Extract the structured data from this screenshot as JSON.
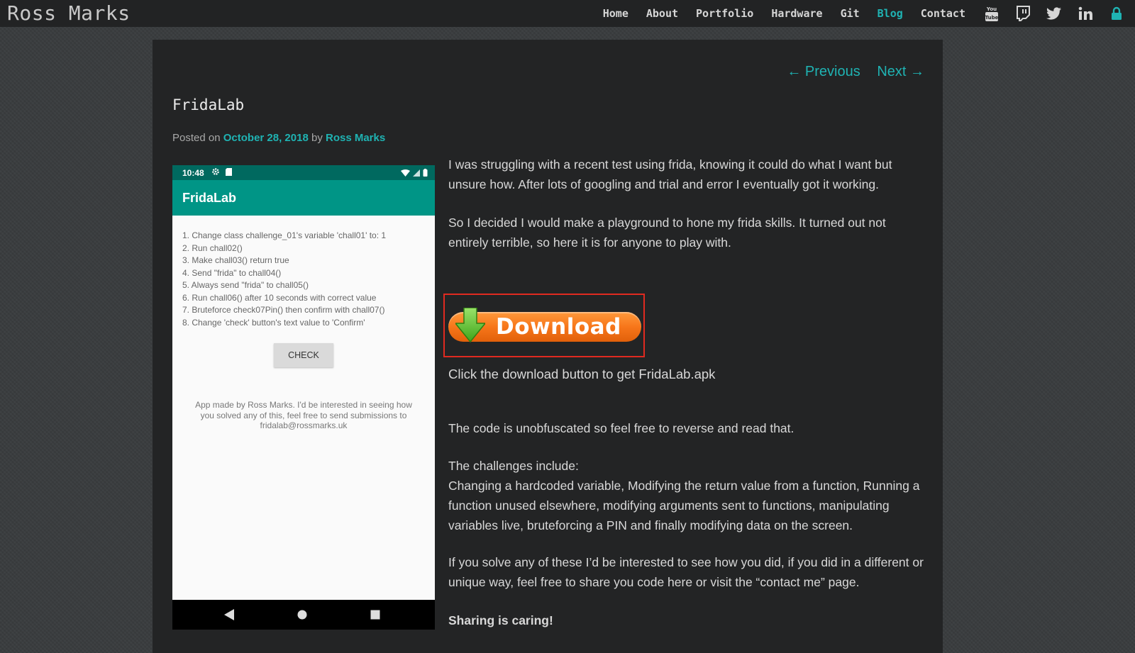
{
  "site": {
    "title": "Ross Marks"
  },
  "nav": {
    "items": [
      {
        "label": "Home"
      },
      {
        "label": "About"
      },
      {
        "label": "Portfolio"
      },
      {
        "label": "Hardware"
      },
      {
        "label": "Git"
      },
      {
        "label": "Blog",
        "active": true
      },
      {
        "label": "Contact"
      }
    ],
    "social_icons": [
      "youtube-icon",
      "twitch-icon",
      "twitter-icon",
      "linkedin-icon",
      "lock-icon"
    ]
  },
  "post_nav": {
    "previous": "← Previous",
    "next": "Next →"
  },
  "post": {
    "title": "FridaLab",
    "meta": {
      "posted_on": "Posted on",
      "date": "October 28, 2018",
      "by": "by",
      "author": "Ross Marks"
    }
  },
  "phone": {
    "time": "10:48",
    "app_title": "FridaLab",
    "challenges": [
      "1. Change class challenge_01's variable 'chall01' to: 1",
      "2. Run chall02()",
      "3. Make chall03() return true",
      "4. Send \"frida\" to chall04()",
      "5. Always send \"frida\" to chall05()",
      "6. Run chall06() after 10 seconds with correct value",
      "7. Bruteforce check07Pin() then confirm with chall07()",
      "8. Change 'check' button's text value to 'Confirm'"
    ],
    "check_button": "CHECK",
    "credit": "App made by Ross Marks. I'd be interested in seeing how you solved any of this, feel free to send submissions to fridalab@rossmarks.uk"
  },
  "body": {
    "p1": "I was struggling with a recent test using frida, knowing it could do what I want but unsure how. After lots of googling and trial and error I eventually got it working.",
    "p2": "So I decided I would make a playground to hone my frida skills. It turned out not entirely terrible, so here it is for anyone to play with.",
    "download_label": "Download",
    "download_caption": "Click the download button to get FridaLab.apk",
    "p3": "The code is unobfuscated so feel free to reverse and read that.",
    "challenges_heading": "The challenges include:",
    "challenges_text": "Changing a hardcoded variable, Modifying the return value from a function, Running a function unused elsewhere, modifying arguments sent to functions, manipulating variables live, bruteforcing a PIN and finally modifying data on the screen.",
    "p4": "If you solve any of these I’d be interested to see how you did, if you did in a different or unique way, feel free to share you code here or visit the “contact me” page.",
    "sharing": "Sharing is caring!"
  },
  "colors": {
    "accent": "#1fb3b3",
    "download_border": "#e02a20",
    "app_bar": "#009586"
  }
}
